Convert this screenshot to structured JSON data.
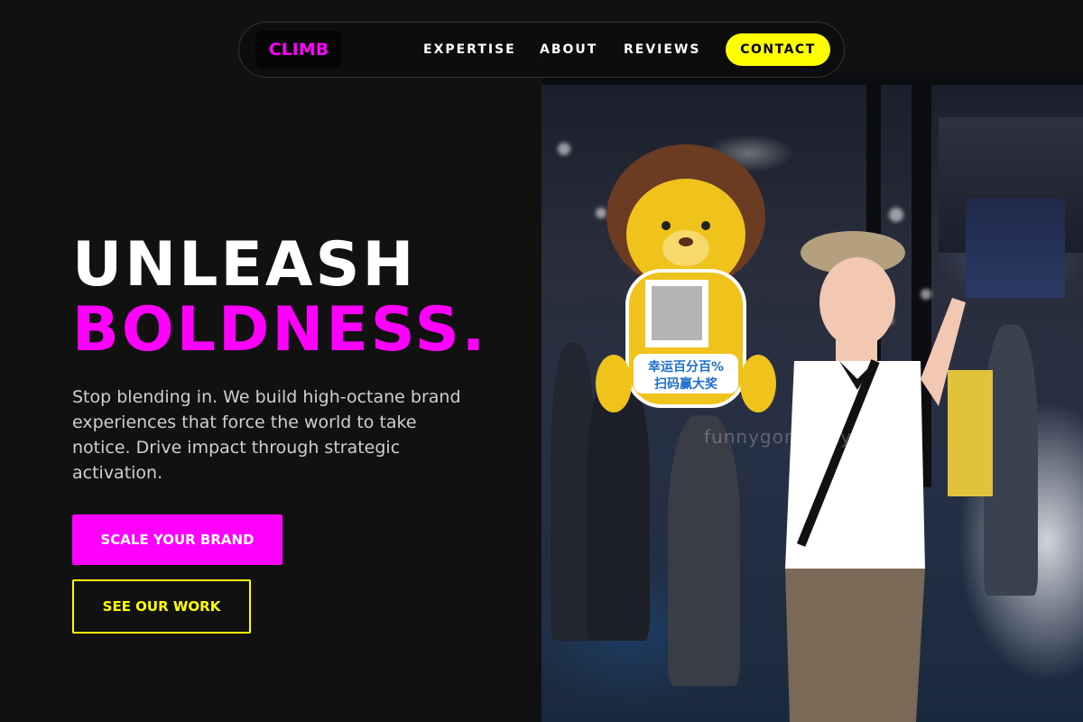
{
  "nav": {
    "logo": "CLIMB",
    "links": [
      "EXPERTISE",
      "ABOUT",
      "REVIEWS"
    ],
    "cta": "CONTACT"
  },
  "hero": {
    "headline_line1": "UNLEASH",
    "headline_line2": "BOLDNESS.",
    "tagline": "Stop blending in. We build high-octane brand experiences that force the world to take notice. Drive impact through strategic activation.",
    "primary_button": "SCALE YOUR BRAND",
    "secondary_button": "SEE OUR WORK"
  },
  "photo": {
    "watermark": "funnygorilla.xyz",
    "sign_text_line1": "幸运百分百%",
    "sign_text_line2": "扫码赢大奖"
  },
  "colors": {
    "background": "#111111",
    "accent_magenta": "#ff00ff",
    "accent_yellow": "#ffff00"
  }
}
